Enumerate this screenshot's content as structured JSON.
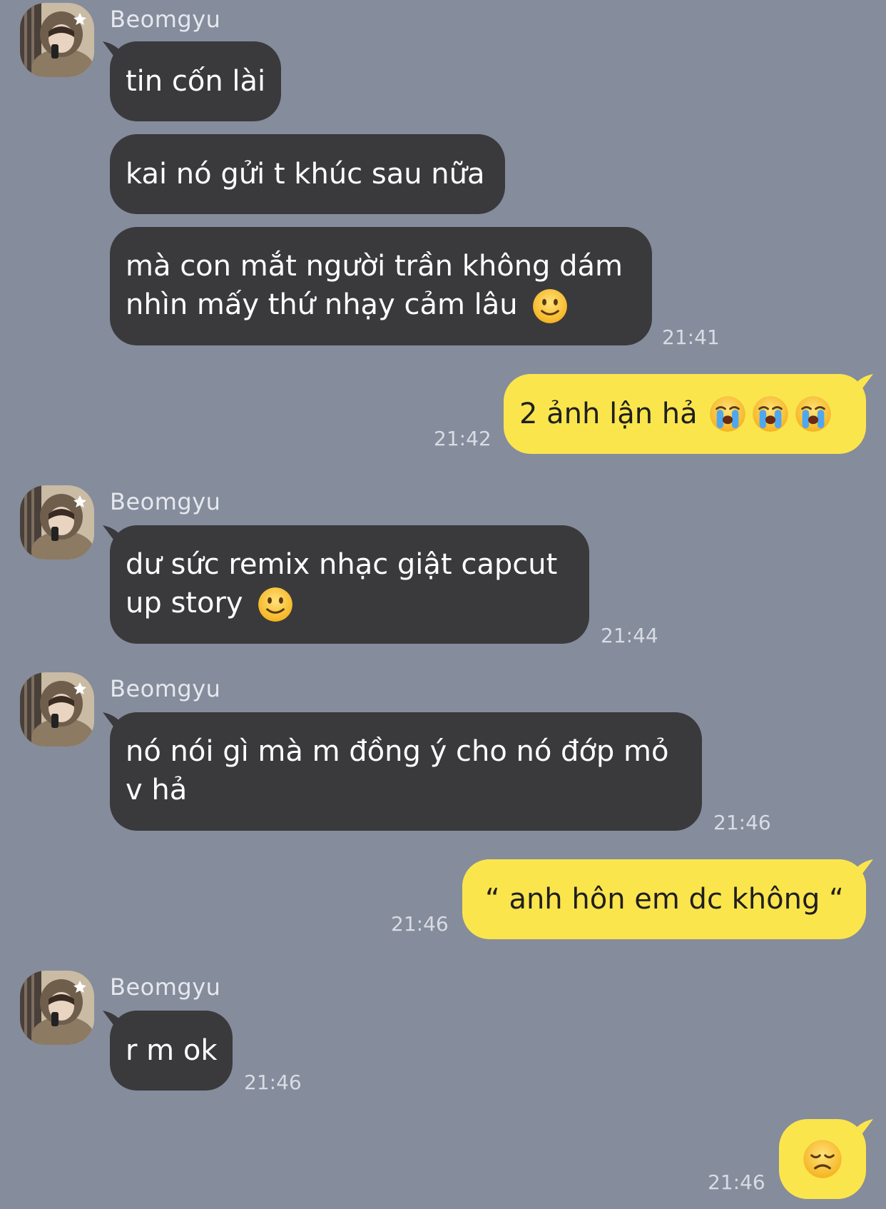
{
  "colors": {
    "background": "#858c9c",
    "incoming_bubble": "#3a3a3d",
    "outgoing_bubble": "#fbe54d"
  },
  "groups": [
    {
      "sender": "Beomgyu",
      "messages": [
        {
          "text": "tin cốn lài"
        },
        {
          "text": "kai nó gửi t khúc sau nữa"
        },
        {
          "line1": "mà con mắt người trần không dám",
          "line2": "nhìn mấy thứ nhạy cảm lâu",
          "emoji": "slightly-smiling-face",
          "time": "21:41"
        }
      ]
    },
    {
      "sender": "Beomgyu",
      "messages": [
        {
          "line1": "dư sức remix nhạc giật capcut",
          "line2": "up story",
          "emoji": "slightly-smiling-face",
          "time": "21:44"
        }
      ]
    },
    {
      "sender": "Beomgyu",
      "messages": [
        {
          "line1": "nó nói gì mà m đồng ý cho nó đớp mỏ",
          "line2": "v hả",
          "time": "21:46"
        }
      ]
    },
    {
      "sender": "Beomgyu",
      "messages": [
        {
          "text": "r m ok",
          "time": "21:46"
        }
      ]
    }
  ],
  "outgoing": [
    {
      "text": "2 ảnh lận hả",
      "emojis": [
        "loudly-crying-face",
        "loudly-crying-face",
        "loudly-crying-face"
      ],
      "time": "21:42"
    },
    {
      "text": "“ anh hôn em dc không “",
      "time": "21:46"
    },
    {
      "text": "",
      "emojis": [
        "disappointed-face"
      ],
      "time": "21:46"
    }
  ]
}
